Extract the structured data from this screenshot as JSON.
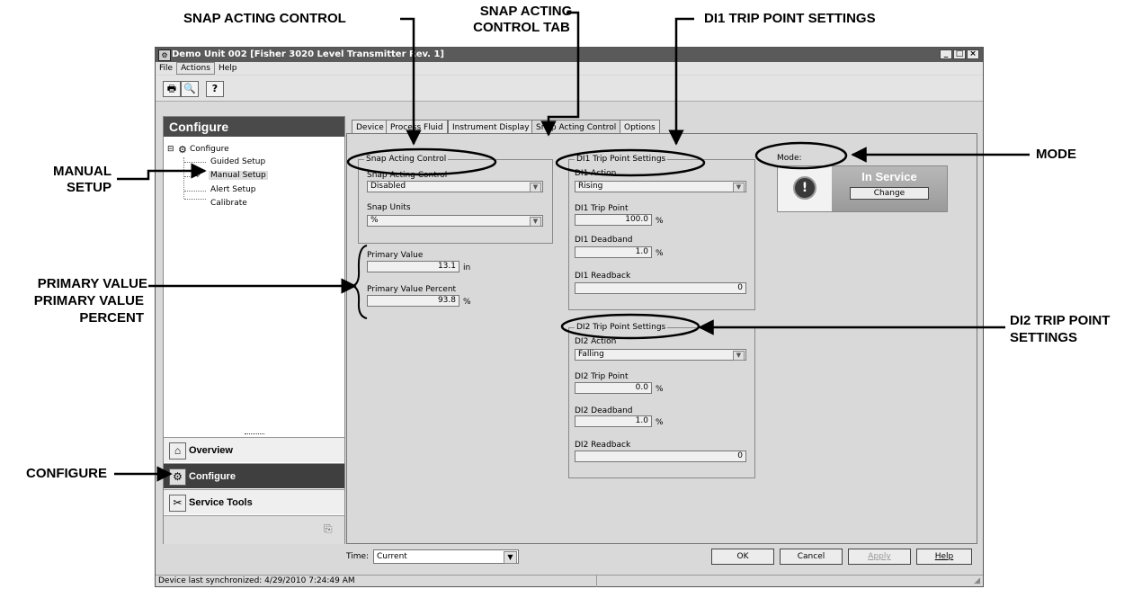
{
  "callouts": {
    "snap_acting_control": "SNAP ACTING CONTROL",
    "snap_acting_control_tab_1": "SNAP ACTING",
    "snap_acting_control_tab_2": "CONTROL TAB",
    "di1_trip_point_settings": "DI1 TRIP POINT SETTINGS",
    "mode": "MODE",
    "manual_setup_1": "MANUAL",
    "manual_setup_2": "SETUP",
    "primary_value_1": "PRIMARY VALUE",
    "primary_value_2": "PRIMARY VALUE",
    "primary_value_3": "PERCENT",
    "di2_trip_point_settings_1": "DI2 TRIP POINT",
    "di2_trip_point_settings_2": "SETTINGS",
    "configure": "CONFIGURE"
  },
  "window": {
    "title": "Demo Unit 002 [Fisher 3020 Level Transmitter Rev. 1]",
    "min": "_",
    "max": "□",
    "close": "×"
  },
  "menu": [
    "File",
    "Actions",
    "Help"
  ],
  "toolbar": {
    "print": "🖶",
    "preview": "🔍",
    "help": "?"
  },
  "left": {
    "heading": "Configure",
    "tree": {
      "root": "Configure",
      "items": [
        "Guided Setup",
        "Manual Setup",
        "Alert Setup",
        "Calibrate"
      ]
    },
    "nav": [
      "Overview",
      "Configure",
      "Service Tools"
    ]
  },
  "tabs": [
    "Device",
    "Process Fluid",
    "Instrument Display",
    "Snap Acting Control",
    "Options"
  ],
  "snap": {
    "group_title": "Snap Acting Control",
    "control_label": "Snap Acting Control",
    "control_value": "Disabled",
    "units_label": "Snap Units",
    "units_value": "%"
  },
  "primary": {
    "value_label": "Primary Value",
    "value": "13.1",
    "value_unit": "in",
    "percent_label": "Primary Value Percent",
    "percent": "93.8",
    "percent_unit": "%"
  },
  "di1": {
    "group_title": "DI1 Trip Point Settings",
    "action_label": "DI1 Action",
    "action_value": "Rising",
    "trip_label": "DI1 Trip Point",
    "trip_value": "100.0",
    "trip_unit": "%",
    "deadband_label": "DI1 Deadband",
    "deadband_value": "1.0",
    "deadband_unit": "%",
    "readback_label": "DI1 Readback",
    "readback_value": "0"
  },
  "di2": {
    "group_title": "DI2 Trip Point Settings",
    "action_label": "DI2 Action",
    "action_value": "Falling",
    "trip_label": "DI2 Trip Point",
    "trip_value": "0.0",
    "trip_unit": "%",
    "deadband_label": "DI2 Deadband",
    "deadband_value": "1.0",
    "deadband_unit": "%",
    "readback_label": "DI2 Readback",
    "readback_value": "0"
  },
  "mode": {
    "label": "Mode:",
    "status": "In Service",
    "change": "Change"
  },
  "bottom": {
    "time_label": "Time:",
    "time_value": "Current",
    "ok": "OK",
    "cancel": "Cancel",
    "apply": "Apply",
    "help": "Help"
  },
  "status_bar": "Device last synchronized: 4/29/2010 7:24:49 AM"
}
